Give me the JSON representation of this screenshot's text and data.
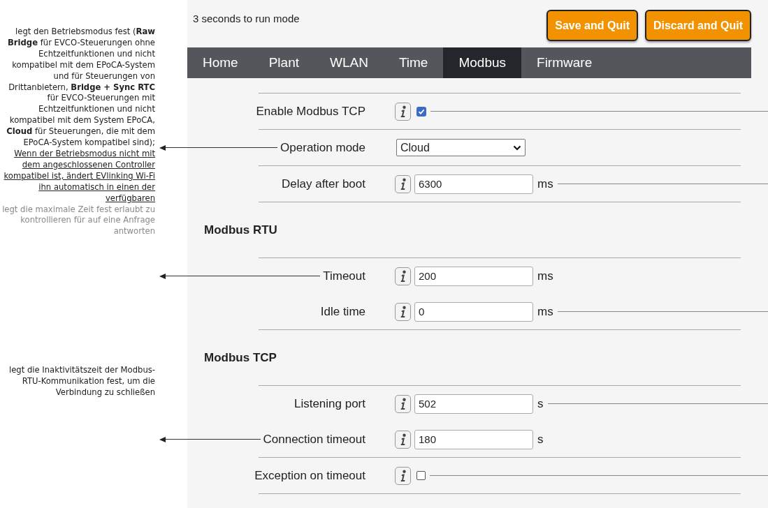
{
  "status": "3 seconds to run mode",
  "buttons": [
    "Save and Quit",
    "Discard and Quit"
  ],
  "tabs": [
    {
      "label": "Home",
      "selected": false
    },
    {
      "label": "Plant",
      "selected": false
    },
    {
      "label": "WLAN",
      "selected": false
    },
    {
      "label": "Time",
      "selected": false
    },
    {
      "label": "Modbus",
      "selected": true
    },
    {
      "label": "Firmware",
      "selected": false
    }
  ],
  "sections": [
    {
      "rows": [
        {
          "label": "Enable Modbus TCP",
          "kind": "checkbox",
          "info": true,
          "checked": true,
          "left_leader": false,
          "right_leader": true,
          "rule": true
        },
        {
          "label": "Operation mode",
          "kind": "select",
          "info": false,
          "value": "Cloud",
          "left_leader": true,
          "right_leader": false,
          "rule": true
        },
        {
          "label": "Delay after boot",
          "kind": "number",
          "info": true,
          "value": "6300",
          "unit": "ms",
          "left_leader": false,
          "right_leader": true,
          "rule": true
        }
      ]
    },
    {
      "heading": "Modbus RTU",
      "rows": [
        {
          "label": "Timeout",
          "kind": "number",
          "info": true,
          "value": "200",
          "unit": "ms",
          "left_leader": true,
          "right_leader": false,
          "rule": false
        },
        {
          "label": "Idle time",
          "kind": "number",
          "info": true,
          "value": "0",
          "unit": "ms",
          "left_leader": false,
          "right_leader": true,
          "rule": true
        }
      ]
    },
    {
      "heading": "Modbus TCP",
      "rows": [
        {
          "label": "Listening port",
          "kind": "number",
          "info": true,
          "value": "502",
          "unit": "s",
          "left_leader": false,
          "right_leader": true,
          "rule": false
        },
        {
          "label": "Connection timeout",
          "kind": "number",
          "info": true,
          "value": "180",
          "unit": "s",
          "left_leader": true,
          "right_leader": false,
          "rule": true
        },
        {
          "label": "Exception on timeout",
          "kind": "checkbox",
          "info": true,
          "checked": false,
          "left_leader": false,
          "right_leader": true,
          "rule": true
        }
      ]
    }
  ],
  "callouts": [
    {
      "text": "legt den Betriebsmodus fest (**Raw Bridge** für EVCO-Steuerungen ohne Echtzeitfunktionen und nicht kompatibel mit dem EPoCA-System und für Steuerungen von Drittanbietern, **Bridge + Sync RTC** für EVCO-Steuerungen mit Echtzeitfunktionen und nicht kompatibel mit dem System EPoCA, **Cloud** für Steuerungen, die mit dem EPoCA-System kompatibel sind);",
      "underlined": "Wenn der Betriebsmodus nicht mit dem angeschlossenen Controller kompatibel ist, ändert EVlinking Wi-Fi ihn automatisch in einen der verfügbaren",
      "muted": false
    },
    {
      "text": "legt die maximale Zeit fest erlaubt zu kontrollieren für auf eine Anfrage antworten",
      "muted": true
    },
    {
      "text": "legt die Inaktivitätszeit der Modbus-RTU-Kommunikation fest, um die Verbindung zu schließen",
      "muted": false
    }
  ]
}
